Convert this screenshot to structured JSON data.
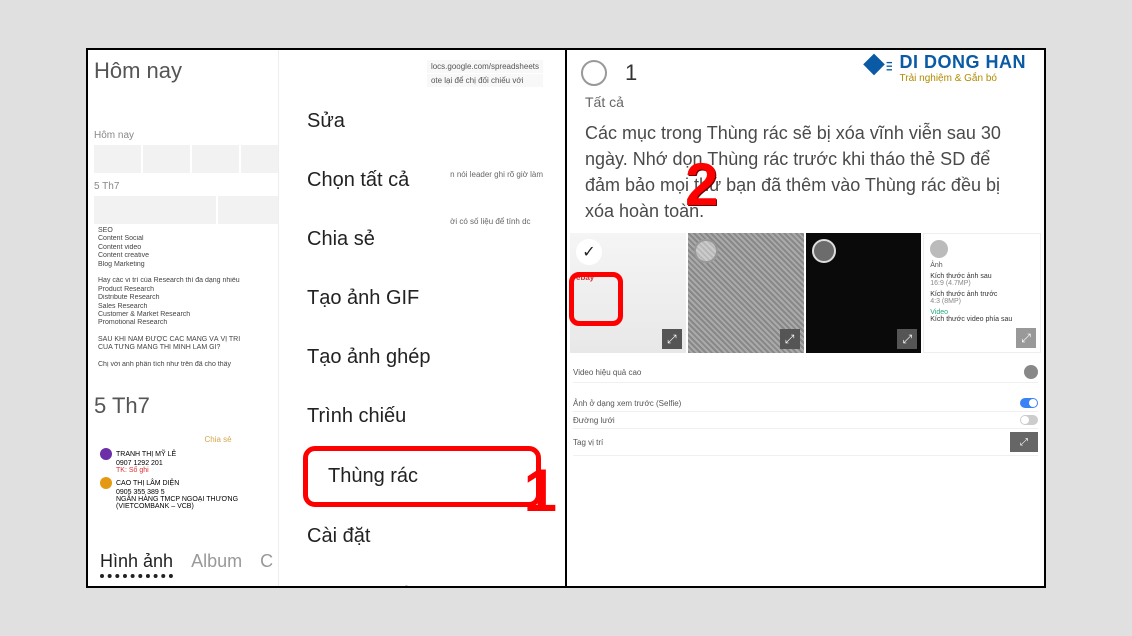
{
  "brand": {
    "name": "DI DONG HAN",
    "tagline": "Trải nghiệm & Gắn bó",
    "logo_color": "#0a5aa6"
  },
  "left": {
    "today": "Hôm nay",
    "today_sub": "Hôm nay",
    "url1": "locs.google.com/spreadsheets",
    "url2": "ote lại để chị đối chiếu với",
    "url3": "n nói leader ghi rõ giờ làm",
    "url4": "ời có số liệu để tính dc",
    "date_prev": "5 Th7",
    "notes_title": "5 Th7",
    "note_lines": [
      "SEO",
      "Content Social",
      "Content video",
      "Content creative",
      "Blog Marketing",
      "",
      "Hay các vi trí của Research thì đa dạng nhiều",
      "Product Research",
      "Distribute Research",
      "Sales Research",
      "Customer & Market Research",
      "Promotional Research",
      "",
      "SAU KHI NÂM ĐƯỢC CÁC MÀNG VÀ VỊ TRÍ",
      "CỦA TỪNG MẢNG THÌ MÌNH LÀM GÌ?",
      "",
      "Chị với anh phần tích như trên đã cho thấy"
    ],
    "contact": {
      "share": "Chia sẻ",
      "name1": "TRANH THỊ MỸ LÊ",
      "phone1": "0907 1292 201",
      "ref": "TK: Sổ ghi",
      "name2": "CAO THỊ LÂM DIỆN",
      "phone2": "0905 355 389 5",
      "bank": "NGÂN HÀNG TMCP NGOẠI THƯƠNG",
      "branch": "(VIETCOMBANK – VCB)"
    },
    "tabs": {
      "images": "Hình ảnh",
      "album": "Album",
      "c": "C"
    },
    "menu": {
      "edit": "Sửa",
      "select_all": "Chọn tất cả",
      "share": "Chia sẻ",
      "create_gif": "Tạo ảnh GIF",
      "collage": "Tạo ảnh ghép",
      "slideshow": "Trình chiếu",
      "trash": "Thùng rác",
      "settings": "Cài đặt",
      "contact_us": "Liên hệ chúng tôi"
    },
    "annotation1": "1"
  },
  "right": {
    "header": {
      "count": "1",
      "all": "Tất cả"
    },
    "desc": "Các mục trong Thùng rác sẽ bị xóa vĩnh viễn sau 30 ngày. Nhớ dọn Thùng rác trước khi tháo thẻ SD để đảm bảo mọi thứ bạn đã thêm vào Thùng rác đều bị xóa hoàn toàn.",
    "annotation2": "2",
    "tile1_label": "ebay",
    "tile4": {
      "line1": "Ảnh",
      "line2": "Kích thước ảnh sau",
      "line2v": "16:9 (4.7MP)",
      "line3": "Kích thước ảnh trước",
      "line3v": "4:3 (8MP)",
      "line4": "Video",
      "line5": "Kích thước video phía sau"
    },
    "settings_block": {
      "s1": "Video hiệu quả cao",
      "s2": "Ảnh ở dạng xem trước (Selfie)",
      "s3": "Đường lưới",
      "s4": "Tag vị trí"
    }
  }
}
